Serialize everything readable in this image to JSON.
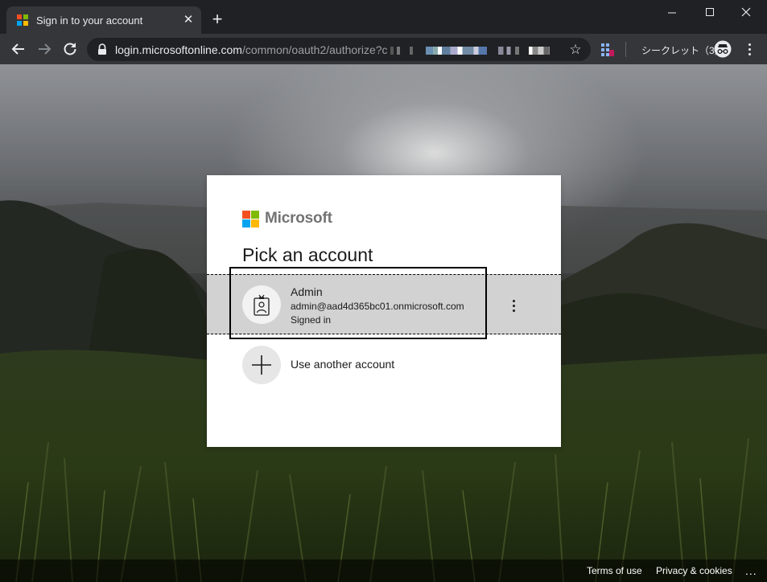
{
  "browser": {
    "tab": {
      "title": "Sign in to your account",
      "close_glyph": "✕"
    },
    "new_tab_glyph": "+",
    "window_controls": {
      "minimize": "minimize-icon",
      "maximize": "maximize-icon",
      "close": "close-icon"
    },
    "url": {
      "host": "login.microsoftonline.com",
      "path": "/common/oauth2/authorize?c"
    },
    "bookmark_glyph": "☆",
    "incognito_label": "シークレット（3）"
  },
  "card": {
    "logo_text": "Microsoft",
    "logo_colors": [
      "#f25022",
      "#7fba00",
      "#00a4ef",
      "#ffb900"
    ],
    "title": "Pick an account",
    "account": {
      "name": "Admin",
      "email": "admin@aad4d365bc01.onmicrosoft.com",
      "status": "Signed in"
    },
    "other_account_label": "Use another account"
  },
  "footer": {
    "terms": "Terms of use",
    "privacy": "Privacy & cookies",
    "more": "..."
  }
}
